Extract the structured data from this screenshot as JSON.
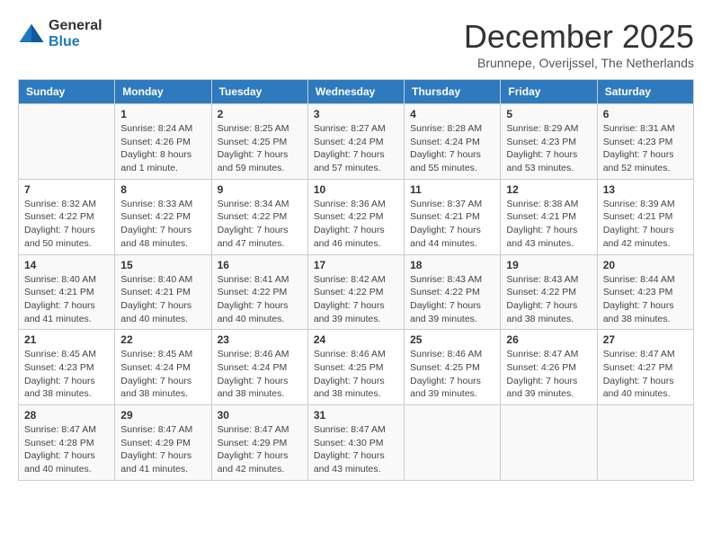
{
  "logo": {
    "general": "General",
    "blue": "Blue"
  },
  "header": {
    "title": "December 2025",
    "subtitle": "Brunnepe, Overijssel, The Netherlands"
  },
  "days_of_week": [
    "Sunday",
    "Monday",
    "Tuesday",
    "Wednesday",
    "Thursday",
    "Friday",
    "Saturday"
  ],
  "weeks": [
    [
      {
        "day": "",
        "info": ""
      },
      {
        "day": "1",
        "info": "Sunrise: 8:24 AM\nSunset: 4:26 PM\nDaylight: 8 hours\nand 1 minute."
      },
      {
        "day": "2",
        "info": "Sunrise: 8:25 AM\nSunset: 4:25 PM\nDaylight: 7 hours\nand 59 minutes."
      },
      {
        "day": "3",
        "info": "Sunrise: 8:27 AM\nSunset: 4:24 PM\nDaylight: 7 hours\nand 57 minutes."
      },
      {
        "day": "4",
        "info": "Sunrise: 8:28 AM\nSunset: 4:24 PM\nDaylight: 7 hours\nand 55 minutes."
      },
      {
        "day": "5",
        "info": "Sunrise: 8:29 AM\nSunset: 4:23 PM\nDaylight: 7 hours\nand 53 minutes."
      },
      {
        "day": "6",
        "info": "Sunrise: 8:31 AM\nSunset: 4:23 PM\nDaylight: 7 hours\nand 52 minutes."
      }
    ],
    [
      {
        "day": "7",
        "info": "Sunrise: 8:32 AM\nSunset: 4:22 PM\nDaylight: 7 hours\nand 50 minutes."
      },
      {
        "day": "8",
        "info": "Sunrise: 8:33 AM\nSunset: 4:22 PM\nDaylight: 7 hours\nand 48 minutes."
      },
      {
        "day": "9",
        "info": "Sunrise: 8:34 AM\nSunset: 4:22 PM\nDaylight: 7 hours\nand 47 minutes."
      },
      {
        "day": "10",
        "info": "Sunrise: 8:36 AM\nSunset: 4:22 PM\nDaylight: 7 hours\nand 46 minutes."
      },
      {
        "day": "11",
        "info": "Sunrise: 8:37 AM\nSunset: 4:21 PM\nDaylight: 7 hours\nand 44 minutes."
      },
      {
        "day": "12",
        "info": "Sunrise: 8:38 AM\nSunset: 4:21 PM\nDaylight: 7 hours\nand 43 minutes."
      },
      {
        "day": "13",
        "info": "Sunrise: 8:39 AM\nSunset: 4:21 PM\nDaylight: 7 hours\nand 42 minutes."
      }
    ],
    [
      {
        "day": "14",
        "info": "Sunrise: 8:40 AM\nSunset: 4:21 PM\nDaylight: 7 hours\nand 41 minutes."
      },
      {
        "day": "15",
        "info": "Sunrise: 8:40 AM\nSunset: 4:21 PM\nDaylight: 7 hours\nand 40 minutes."
      },
      {
        "day": "16",
        "info": "Sunrise: 8:41 AM\nSunset: 4:22 PM\nDaylight: 7 hours\nand 40 minutes."
      },
      {
        "day": "17",
        "info": "Sunrise: 8:42 AM\nSunset: 4:22 PM\nDaylight: 7 hours\nand 39 minutes."
      },
      {
        "day": "18",
        "info": "Sunrise: 8:43 AM\nSunset: 4:22 PM\nDaylight: 7 hours\nand 39 minutes."
      },
      {
        "day": "19",
        "info": "Sunrise: 8:43 AM\nSunset: 4:22 PM\nDaylight: 7 hours\nand 38 minutes."
      },
      {
        "day": "20",
        "info": "Sunrise: 8:44 AM\nSunset: 4:23 PM\nDaylight: 7 hours\nand 38 minutes."
      }
    ],
    [
      {
        "day": "21",
        "info": "Sunrise: 8:45 AM\nSunset: 4:23 PM\nDaylight: 7 hours\nand 38 minutes."
      },
      {
        "day": "22",
        "info": "Sunrise: 8:45 AM\nSunset: 4:24 PM\nDaylight: 7 hours\nand 38 minutes."
      },
      {
        "day": "23",
        "info": "Sunrise: 8:46 AM\nSunset: 4:24 PM\nDaylight: 7 hours\nand 38 minutes."
      },
      {
        "day": "24",
        "info": "Sunrise: 8:46 AM\nSunset: 4:25 PM\nDaylight: 7 hours\nand 38 minutes."
      },
      {
        "day": "25",
        "info": "Sunrise: 8:46 AM\nSunset: 4:25 PM\nDaylight: 7 hours\nand 39 minutes."
      },
      {
        "day": "26",
        "info": "Sunrise: 8:47 AM\nSunset: 4:26 PM\nDaylight: 7 hours\nand 39 minutes."
      },
      {
        "day": "27",
        "info": "Sunrise: 8:47 AM\nSunset: 4:27 PM\nDaylight: 7 hours\nand 40 minutes."
      }
    ],
    [
      {
        "day": "28",
        "info": "Sunrise: 8:47 AM\nSunset: 4:28 PM\nDaylight: 7 hours\nand 40 minutes."
      },
      {
        "day": "29",
        "info": "Sunrise: 8:47 AM\nSunset: 4:29 PM\nDaylight: 7 hours\nand 41 minutes."
      },
      {
        "day": "30",
        "info": "Sunrise: 8:47 AM\nSunset: 4:29 PM\nDaylight: 7 hours\nand 42 minutes."
      },
      {
        "day": "31",
        "info": "Sunrise: 8:47 AM\nSunset: 4:30 PM\nDaylight: 7 hours\nand 43 minutes."
      },
      {
        "day": "",
        "info": ""
      },
      {
        "day": "",
        "info": ""
      },
      {
        "day": "",
        "info": ""
      }
    ]
  ]
}
